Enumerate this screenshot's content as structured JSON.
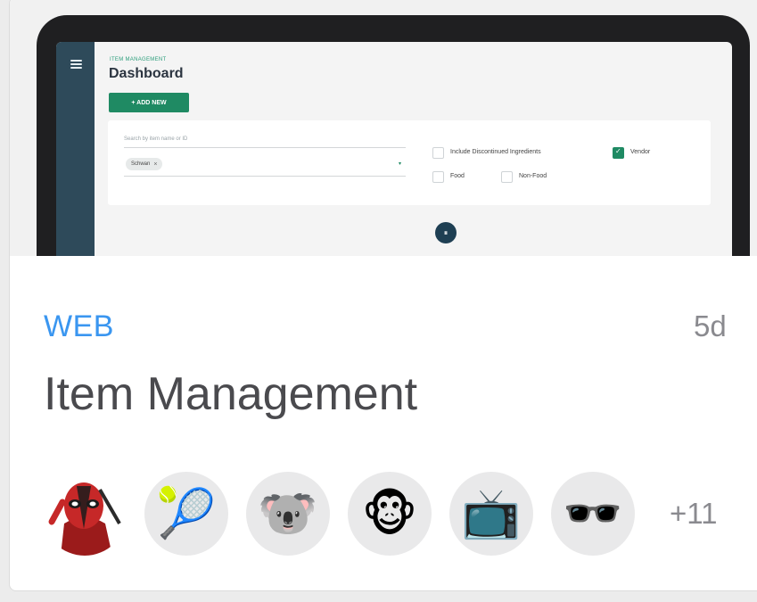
{
  "card": {
    "thumbnail": {
      "app_kicker": "ITEM MANAGEMENT",
      "app_title": "Dashboard",
      "add_button": "+ ADD NEW",
      "search_placeholder": "Search by item name or ID",
      "chip_label": "Schwan",
      "checkboxes": [
        {
          "label": "Include Discontinued Ingredients",
          "checked": false
        },
        {
          "label": "Vendor",
          "checked": true
        },
        {
          "label": "Food",
          "checked": false
        },
        {
          "label": "Non-Food",
          "checked": false
        }
      ]
    },
    "type_label": "WEB",
    "age": "5d",
    "title": "Item Management",
    "avatars": [
      {
        "name": "deadpool-avatar",
        "glyph": "🦹"
      },
      {
        "name": "tennis-ball-avatar",
        "glyph": "🎾"
      },
      {
        "name": "koala-avatar",
        "glyph": "🐨"
      },
      {
        "name": "monkey-avatar",
        "glyph": "🐵"
      },
      {
        "name": "television-avatar",
        "glyph": "📺"
      },
      {
        "name": "sunglasses-avatar",
        "glyph": "🕶️"
      }
    ],
    "more_count": "+11"
  },
  "colors": {
    "type_label": "#3a96f0",
    "sidebar": "#2e4a5a",
    "accent_green": "#1f8a63"
  }
}
